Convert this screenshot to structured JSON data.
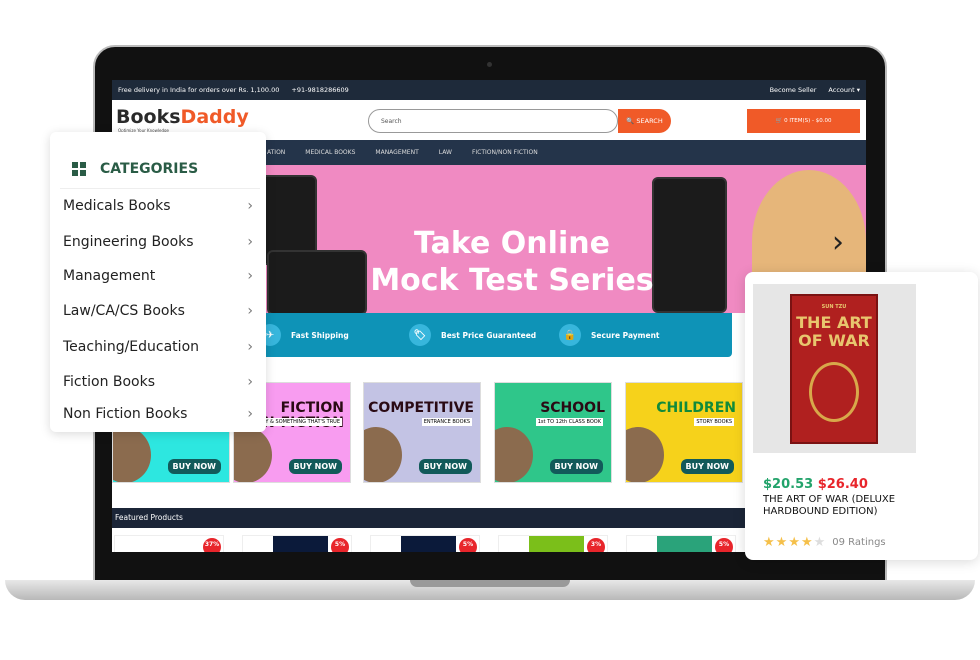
{
  "topbar": {
    "delivery": "Free delivery in India for orders over Rs. 1,100.00",
    "phone": "+91-9818286609",
    "become_seller": "Become Seller",
    "account": "Account ▾"
  },
  "header": {
    "logo_a": "Books",
    "logo_b": "Daddy",
    "tagline": "Optimize Your Knowledge",
    "search_placeholder": "Search",
    "search_button": "🔍 SEARCH",
    "cart": "🛒 0 ITEM(S) - $0.00"
  },
  "nav": [
    "ATION",
    "MEDICAL BOOKS",
    "MANAGEMENT",
    "LAW",
    "FICTION/NON FICTION"
  ],
  "banner": {
    "line1": "Take Online",
    "line2": "Mock Test Series",
    "arrow": "›"
  },
  "features": [
    {
      "icon": "plane-icon",
      "label": "Fast Shipping"
    },
    {
      "icon": "tag-icon",
      "label": "Best Price Guaranteed"
    },
    {
      "icon": "lock-icon",
      "label": "Secure Payment"
    }
  ],
  "tiles": [
    {
      "title": "",
      "sub": "",
      "buy": "BUY NOW",
      "color": "#2de7e0"
    },
    {
      "title": "FICTION\nNON-FICTION",
      "sub": "IMAGINARY & SOMETHING THAT'S TRUE",
      "buy": "BUY NOW",
      "color": "#f89cf0"
    },
    {
      "title": "COMPETITIVE",
      "sub": "ENTRANCE BOOKS",
      "buy": "BUY NOW",
      "color": "#c3c3e4"
    },
    {
      "title": "SCHOOL",
      "sub": "1st TO 12th CLASS BOOK",
      "buy": "BUY NOW",
      "color": "#2fc68a"
    },
    {
      "title": "CHILDREN",
      "sub": "STORY BOOKS",
      "buy": "BUY NOW",
      "color": "#f6d21b"
    }
  ],
  "featured_title": "Featured Products",
  "products": [
    {
      "discount": "37%"
    },
    {
      "discount": "5%"
    },
    {
      "discount": "5%"
    },
    {
      "discount": "3%"
    },
    {
      "discount": "5%"
    }
  ],
  "categories": {
    "title": "CATEGORIES",
    "items": [
      "Medicals Books",
      "Engineering Books",
      "Management",
      "Law/CA/CS Books",
      "Teaching/Education",
      "Fiction Books",
      "Non Fiction Books"
    ]
  },
  "product_card": {
    "cover_title": "THE ART OF WAR",
    "cover_author": "SUN TZU",
    "price": "$20.53",
    "old_price": "$26.40",
    "title": "THE ART OF WAR (DELUXE HARDBOUND EDITION)",
    "rating": 4,
    "rating_max": 5,
    "ratings_text": "09 Ratings"
  },
  "colors": {
    "accent": "#f05a28",
    "navy": "#1e2a3a",
    "green": "#2a5c46"
  }
}
